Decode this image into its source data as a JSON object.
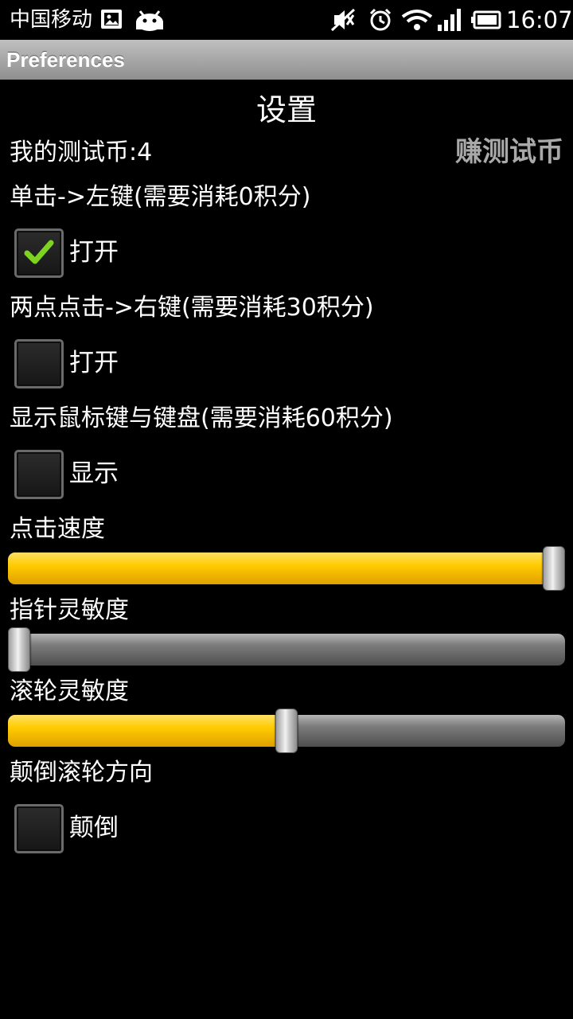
{
  "status_bar": {
    "carrier": "中国移动",
    "time": "16:07",
    "icons": [
      "image-notification-icon",
      "android-notification-icon",
      "silent-mode-icon",
      "alarm-icon",
      "wifi-icon",
      "signal-icon",
      "battery-icon"
    ]
  },
  "title_bar": {
    "title": "Preferences"
  },
  "settings": {
    "heading": "设置",
    "coins_label": "我的测试币:4",
    "earn_button": "赚测试币",
    "left_click": {
      "label": "单击->左键(需要消耗0积分)",
      "checkbox_label": "打开",
      "checked": true
    },
    "right_click": {
      "label": "两点点击->右键(需要消耗30积分)",
      "checkbox_label": "打开",
      "checked": false
    },
    "show_keys": {
      "label": "显示鼠标键与键盘(需要消耗60积分)",
      "checkbox_label": "显示",
      "checked": false
    },
    "click_speed": {
      "label": "点击速度",
      "value_fraction": 1.0
    },
    "pointer_sensitivity": {
      "label": "指针灵敏度",
      "value_fraction": 0.0
    },
    "wheel_sensitivity": {
      "label": "滚轮灵敏度",
      "value_fraction": 0.5
    },
    "invert_wheel": {
      "label": "颠倒滚轮方向",
      "checkbox_label": "颠倒",
      "checked": false
    }
  },
  "colors": {
    "slider_fill": "#ffcc00",
    "check_mark": "#7ed321",
    "earn_button_text": "#a9a9a9"
  }
}
